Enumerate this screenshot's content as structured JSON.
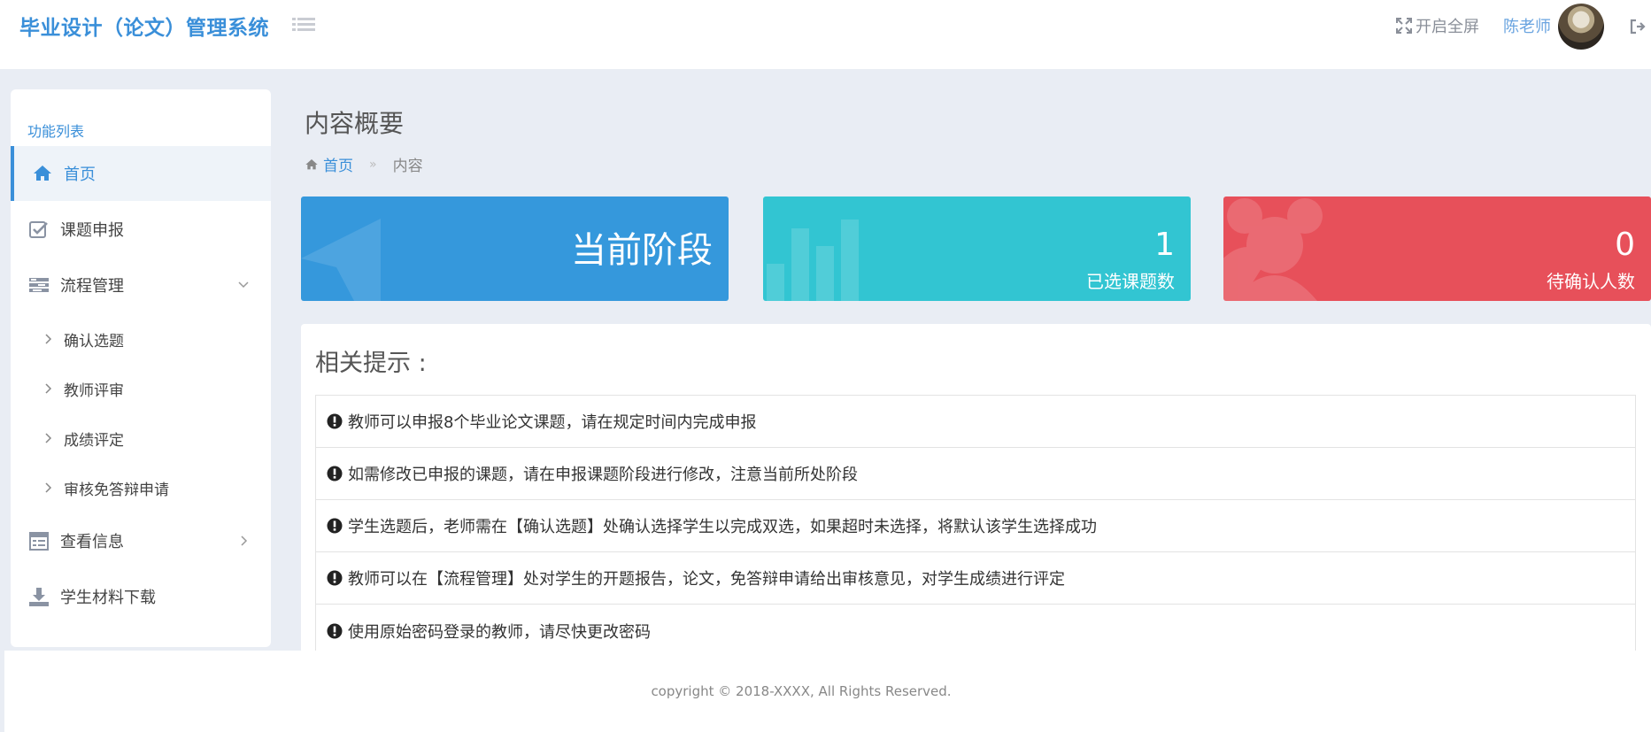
{
  "header": {
    "brand": "毕业设计（论文）管理系统",
    "fullscreen_label": "开启全屏",
    "username": "陈老师"
  },
  "sidebar": {
    "title": "功能列表",
    "items": [
      {
        "label": "首页",
        "icon": "home-icon"
      },
      {
        "label": "课题申报",
        "icon": "check-square-icon"
      },
      {
        "label": "流程管理",
        "icon": "tasks-icon"
      },
      {
        "label": "查看信息",
        "icon": "calendar-icon"
      },
      {
        "label": "学生材料下载",
        "icon": "download-icon"
      }
    ],
    "subitems": [
      {
        "label": "确认选题"
      },
      {
        "label": "教师评审"
      },
      {
        "label": "成绩评定"
      },
      {
        "label": "审核免答辩申请"
      }
    ]
  },
  "main": {
    "title": "内容概要",
    "breadcrumb": {
      "home": "首页",
      "separator": "»",
      "current": "内容"
    },
    "cards": [
      {
        "text": "当前阶段",
        "color": "#3598dc"
      },
      {
        "value": "1",
        "label": "已选课题数",
        "color": "#32c5d2"
      },
      {
        "value": "0",
        "label": "待确认人数",
        "color": "#e7505a"
      }
    ],
    "tips_title": "相关提示 :",
    "tips": [
      "教师可以申报8个毕业论文课题，请在规定时间内完成申报",
      "如需修改已申报的课题，请在申报课题阶段进行修改，注意当前所处阶段",
      "学生选题后，老师需在【确认选题】处确认选择学生以完成双选，如果超时未选择，将默认该学生选择成功",
      "教师可以在【流程管理】处对学生的开题报告，论文，免答辩申请给出审核意见，对学生成绩进行评定",
      "使用原始密码登录的教师，请尽快更改密码"
    ]
  },
  "footer": {
    "copyright": "copyright © 2018-XXXX, All Rights Reserved."
  }
}
